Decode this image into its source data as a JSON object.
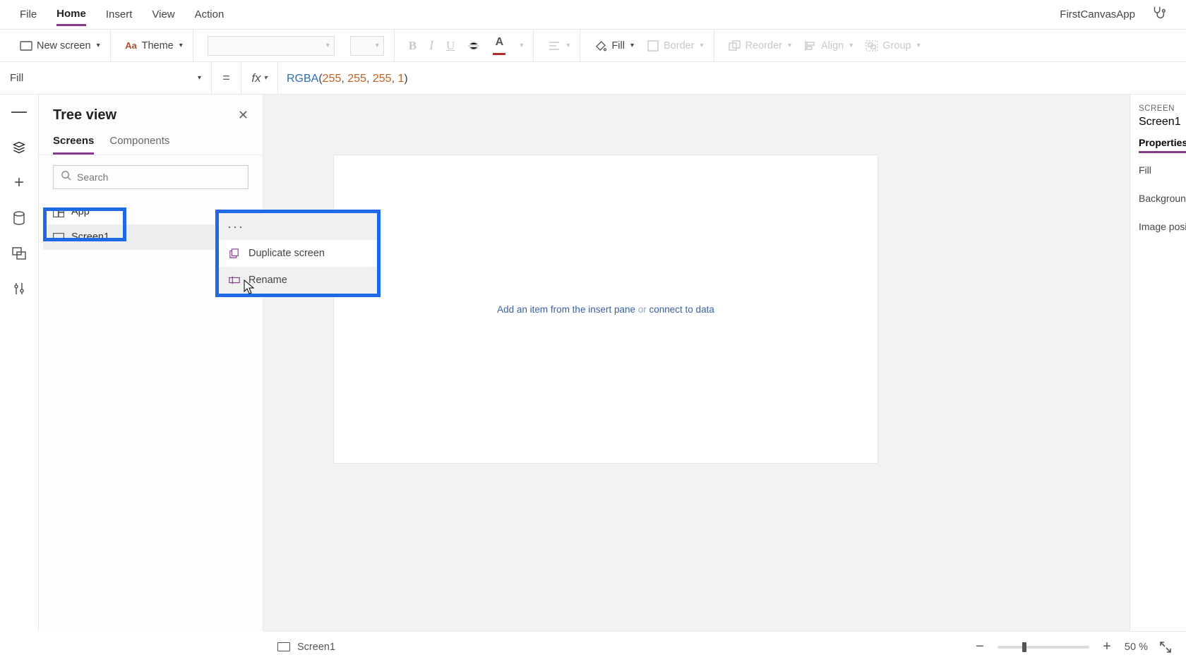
{
  "menu": {
    "file": "File",
    "home": "Home",
    "insert": "Insert",
    "view": "View",
    "action": "Action",
    "app_name": "FirstCanvasApp"
  },
  "ribbon": {
    "new_screen": "New screen",
    "theme": "Theme",
    "fill": "Fill",
    "border": "Border",
    "reorder": "Reorder",
    "align": "Align",
    "group": "Group"
  },
  "formula": {
    "property": "Fill",
    "equals": "=",
    "fx": "fx",
    "fn": "RGBA",
    "arg1": "255",
    "arg2": "255",
    "arg3": "255",
    "arg4": "1"
  },
  "tree": {
    "title": "Tree view",
    "tab_screens": "Screens",
    "tab_components": "Components",
    "search_placeholder": "Search",
    "app_label": "App",
    "screen1_label": "Screen1"
  },
  "context_menu": {
    "duplicate": "Duplicate screen",
    "rename": "Rename"
  },
  "canvas": {
    "hint_left": "Add an item from the insert pane",
    "hint_or": " or ",
    "hint_right": "connect to data"
  },
  "props": {
    "label": "SCREEN",
    "name": "Screen1",
    "tab": "Properties",
    "fill": "Fill",
    "bg": "Background",
    "img_pos": "Image posit"
  },
  "status": {
    "screen": "Screen1",
    "zoom": "50",
    "pct": "%"
  }
}
